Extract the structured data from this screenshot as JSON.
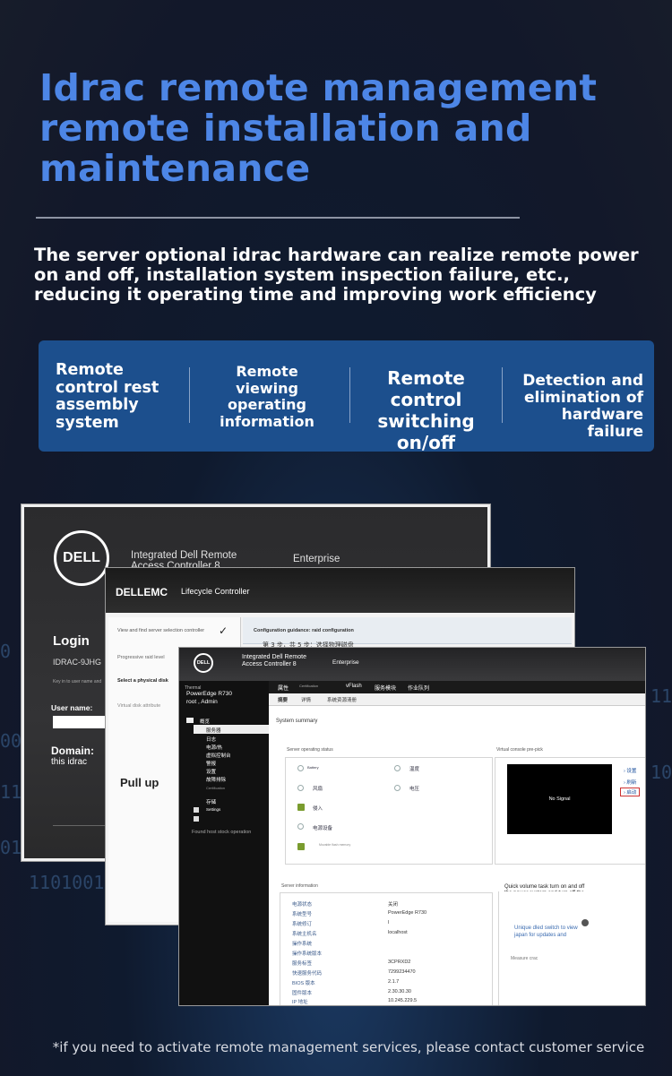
{
  "title_lines": [
    "Idrac remote management",
    "remote installation and",
    "maintenance"
  ],
  "subtitle": "The server optional idrac hardware can realize remote power on and off, installation system inspection failure, etc., reducing it operating time and improving work efficiency",
  "features": [
    {
      "label": "Remote control rest assembly system"
    },
    {
      "label": "Remote viewing operating information"
    },
    {
      "label": "Remote control switching on/off"
    },
    {
      "label": "Detection and elimination of hardware failure"
    }
  ],
  "background_numbers": [
    "0",
    "00",
    "11",
    "01",
    "1101001",
    "110",
    "11",
    "10"
  ],
  "login_screen": {
    "logo": "DELL",
    "product": "Integrated Dell Remote Access Controller 8",
    "edition": "Enterprise",
    "heading": "Login",
    "host": "IDRAC-9JHG",
    "hint": "Key in to user name and",
    "username_label": "User name:",
    "domain_label": "Domain:",
    "domain_value": "this idrac"
  },
  "lifecycle_screen": {
    "logo": "DELLEMC",
    "app": "Lifecycle Controller",
    "side_items": [
      "View and find server selection controller",
      "Progressive raid level",
      "Select a physical disk",
      "Virtual disk attribute"
    ],
    "guidance": "Configuration guidance: raid configuration",
    "step": "第 3 步，共 5 步：选择物理磁盘",
    "pull_up": "Pull up"
  },
  "idrac_screen": {
    "logo": "DELL",
    "product": "Integrated Dell Remote Access Controller 8",
    "edition": "Enterprise",
    "nav": {
      "thermal": "Thermal",
      "server": "PowerEdge R730",
      "user": "root , Admin",
      "items": [
        "概览",
        "服务器",
        "日志",
        "电源/热",
        "虚拟控制台",
        "警报",
        "设置",
        "故障排除",
        "Certification",
        "存储",
        "Settings",
        "Found host stock operation"
      ]
    },
    "tabs": [
      "属性",
      "Certification",
      "vFlash",
      "服务模块",
      "作业队列"
    ],
    "subtabs": [
      "摘要",
      "详情",
      "系统资源清册"
    ],
    "system_summary": "System summary",
    "status_panel": {
      "label": "Server operating status",
      "items": [
        "Battery",
        "温度",
        "风扇",
        "电压",
        "侵入",
        "电源设备",
        "Movable flash memory"
      ]
    },
    "console_panel": {
      "label": "Virtual console pre-pick",
      "no_signal": "No Signal",
      "links": [
        "设置",
        "刷新",
        "启动"
      ]
    },
    "info_panel": {
      "label": "Server information",
      "rows": [
        {
          "k": "电源状态",
          "v": "关闭"
        },
        {
          "k": "系统型号",
          "v": "PowerEdge R730"
        },
        {
          "k": "系统修订",
          "v": "I"
        },
        {
          "k": "系统主机名",
          "v": "localhost"
        },
        {
          "k": "操作系统",
          "v": ""
        },
        {
          "k": "操作系统版本",
          "v": ""
        },
        {
          "k": "服务标签",
          "v": "3CPRXD2"
        },
        {
          "k": "快速服务代码",
          "v": "7299234470"
        },
        {
          "k": "BIOS 版本",
          "v": "2.1.7"
        },
        {
          "k": "固件版本",
          "v": "2.30.30.30"
        },
        {
          "k": "IP 地址",
          "v": "10.245.229.5"
        }
      ]
    },
    "quick_panel": {
      "label": "Quick volume task turn on and off the power system and turn off the machine (can be conducted)",
      "link": "Unique dled switch to view japan for updates and",
      "measure": "Measure crac"
    }
  },
  "footer": "*if you need to activate remote management services, please contact customer service"
}
